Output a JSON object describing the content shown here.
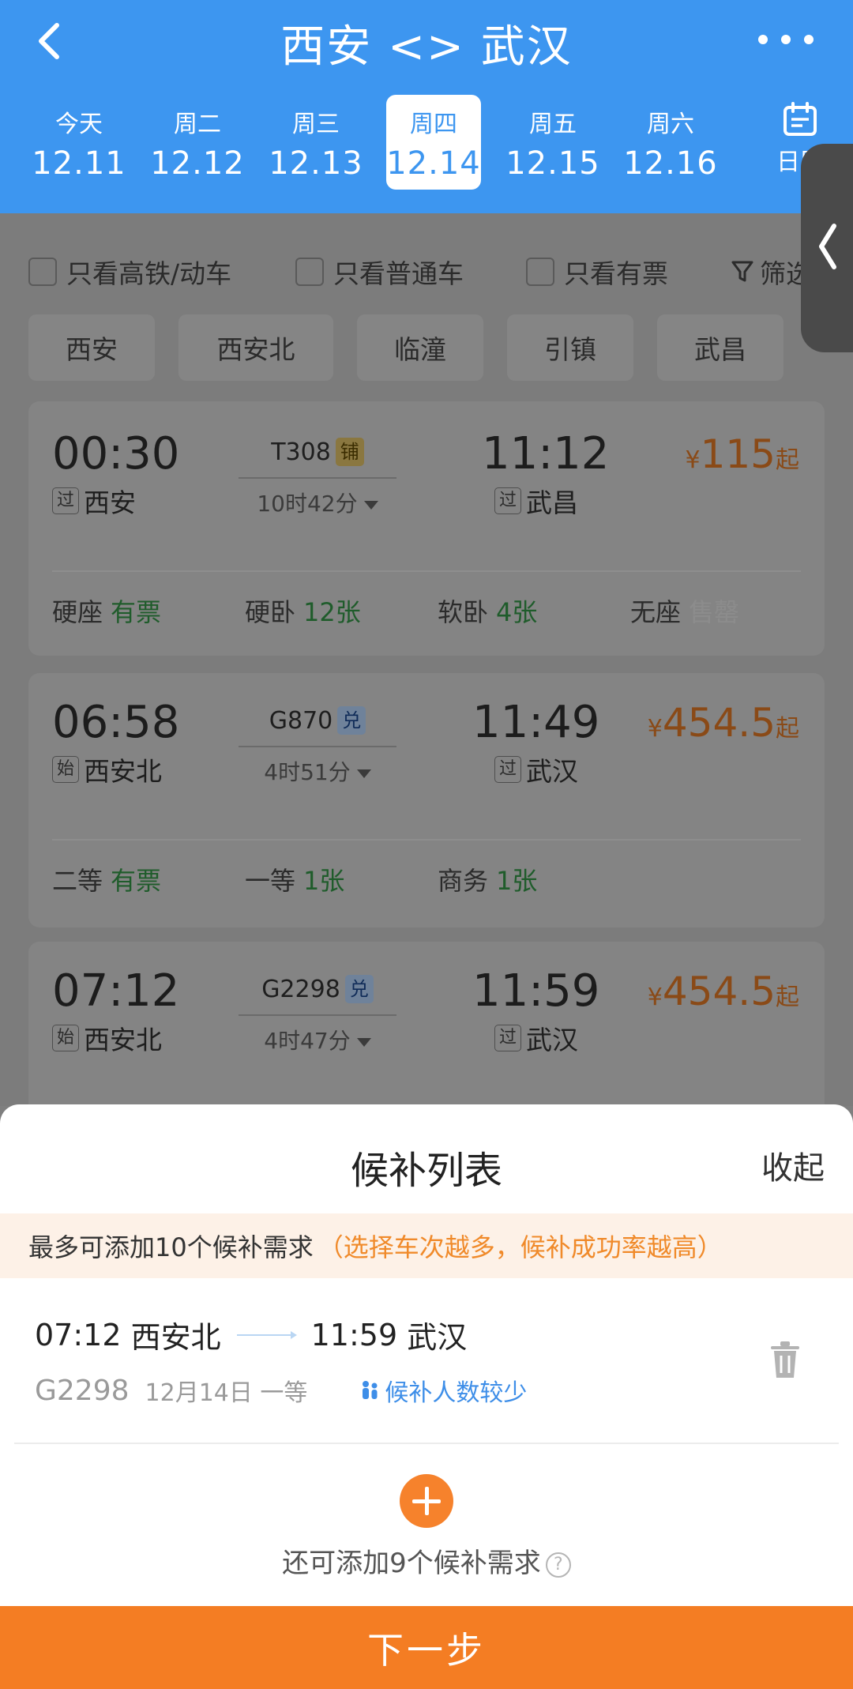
{
  "header": {
    "title": "西安 <> 武汉",
    "dates": [
      {
        "weekday": "今天",
        "date": "12.11",
        "active": false
      },
      {
        "weekday": "周二",
        "date": "12.12",
        "active": false
      },
      {
        "weekday": "周三",
        "date": "12.13",
        "active": false
      },
      {
        "weekday": "周四",
        "date": "12.14",
        "active": true
      },
      {
        "weekday": "周五",
        "date": "12.15",
        "active": false
      },
      {
        "weekday": "周六",
        "date": "12.16",
        "active": false
      }
    ],
    "calendar_label": "日历"
  },
  "filters": {
    "high_speed": "只看高铁/动车",
    "normal": "只看普通车",
    "available": "只看有票",
    "filter": "筛选"
  },
  "stations": [
    "西安",
    "西安北",
    "临潼",
    "引镇",
    "武昌"
  ],
  "trains": [
    {
      "dep_time": "00:30",
      "dep_tag": "过",
      "dep_station": "西安",
      "train_no": "T308",
      "badge": "铺",
      "duration": "10时42分",
      "arr_time": "11:12",
      "arr_tag": "过",
      "arr_station": "武昌",
      "price_symbol": "¥",
      "price": "115",
      "price_suffix": "起",
      "seats": [
        {
          "name": "硬座",
          "value": "有票"
        },
        {
          "name": "硬卧",
          "value": "12张"
        },
        {
          "name": "软卧",
          "value": "4张"
        },
        {
          "name": "无座",
          "value": "售罄"
        }
      ]
    },
    {
      "dep_time": "06:58",
      "dep_tag": "始",
      "dep_station": "西安北",
      "train_no": "G870",
      "badge": "兑",
      "duration": "4时51分",
      "arr_time": "11:49",
      "arr_tag": "过",
      "arr_station": "武汉",
      "price_symbol": "¥",
      "price": "454.5",
      "price_suffix": "起",
      "seats": [
        {
          "name": "二等",
          "value": "有票"
        },
        {
          "name": "一等",
          "value": "1张"
        },
        {
          "name": "商务",
          "value": "1张"
        }
      ]
    },
    {
      "dep_time": "07:12",
      "dep_tag": "始",
      "dep_station": "西安北",
      "train_no": "G2298",
      "badge": "兑",
      "duration": "4时47分",
      "arr_time": "11:59",
      "arr_tag": "过",
      "arr_station": "武汉",
      "price_symbol": "¥",
      "price": "454.5",
      "price_suffix": "起"
    }
  ],
  "sheet": {
    "title": "候补列表",
    "collapse": "收起",
    "notice": "最多可添加10个候补需求",
    "notice_highlight": "（选择车次越多，候补成功率越高）",
    "item": {
      "dep_time": "07:12",
      "dep_station": "西安北",
      "arr_time": "11:59",
      "arr_station": "武汉",
      "train_no": "G2298",
      "date": "12月14日",
      "seat": "一等",
      "status": "候补人数较少"
    },
    "add_tip": "还可添加9个候补需求",
    "next_button": "下一步"
  },
  "colors": {
    "header_blue": "#3d96f0",
    "accent_orange": "#f47d23",
    "status_blue": "#3e8ee8"
  }
}
